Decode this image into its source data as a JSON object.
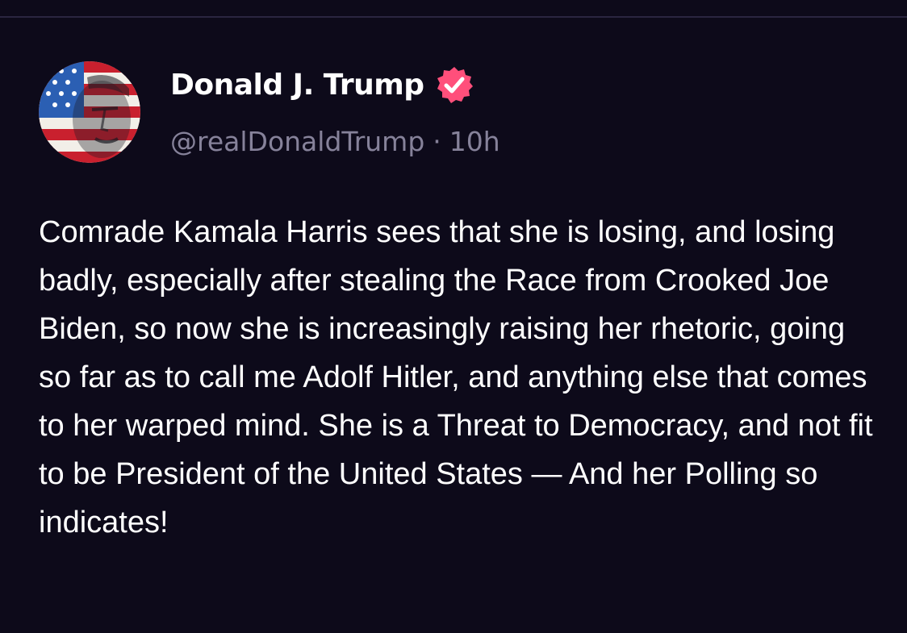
{
  "post": {
    "author": {
      "display_name": "Donald J. Trump",
      "verified_icon": "verified-badge-icon",
      "handle": "@realDonaldTrump",
      "separator": "·",
      "timestamp": "10h",
      "avatar_icon": "american-flag-portrait-avatar"
    },
    "body": "Comrade Kamala Harris sees that she is losing, and losing badly, especially after stealing the Race from Crooked Joe Biden, so now she is increasingly raising her rhetoric, going so far as to call me Adolf Hitler, and anything else that comes to her warped mind. She is a Threat to Democracy, and not fit to be President of the United States — And her Polling so indicates!"
  },
  "colors": {
    "background": "#0d0a1a",
    "text_primary": "#ffffff",
    "text_secondary": "#86829a",
    "verified_badge": "#ff4f7b",
    "divider": "#2a2540"
  }
}
